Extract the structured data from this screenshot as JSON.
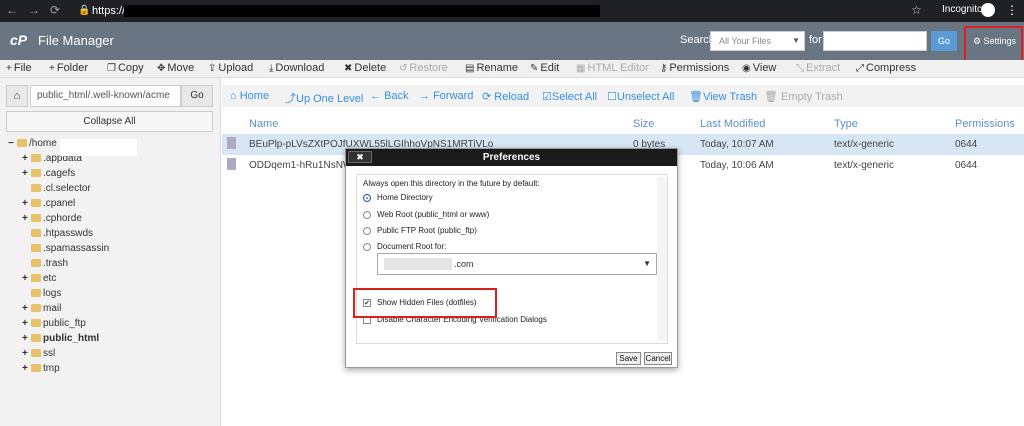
{
  "browser": {
    "url_prefix": "https://",
    "mode_label": "Incognito"
  },
  "header": {
    "app_title": "File Manager",
    "search_label": "Search",
    "search_scope": "All Your Files",
    "for_label": "for",
    "go_label": "Go",
    "settings_label": "Settings"
  },
  "toolbar": [
    {
      "label": "File",
      "icon": "plus-icon",
      "enabled": true
    },
    {
      "label": "Folder",
      "icon": "plus-icon",
      "enabled": true
    },
    {
      "label": "Copy",
      "icon": "copy-icon",
      "enabled": true
    },
    {
      "label": "Move",
      "icon": "move-icon",
      "enabled": true
    },
    {
      "label": "Upload",
      "icon": "upload-icon",
      "enabled": true
    },
    {
      "label": "Download",
      "icon": "download-icon",
      "enabled": true
    },
    {
      "label": "Delete",
      "icon": "delete-icon",
      "enabled": true
    },
    {
      "label": "Restore",
      "icon": "restore-icon",
      "enabled": false
    },
    {
      "label": "Rename",
      "icon": "rename-icon",
      "enabled": true
    },
    {
      "label": "Edit",
      "icon": "edit-icon",
      "enabled": true
    },
    {
      "label": "HTML Editor",
      "icon": "html-editor-icon",
      "enabled": false
    },
    {
      "label": "Permissions",
      "icon": "key-icon",
      "enabled": true
    },
    {
      "label": "View",
      "icon": "eye-icon",
      "enabled": true
    },
    {
      "label": "Extract",
      "icon": "extract-icon",
      "enabled": false
    },
    {
      "label": "Compress",
      "icon": "compress-icon",
      "enabled": true
    }
  ],
  "sidebar": {
    "path_value": "public_html/.well-known/acme",
    "go_label": "Go",
    "collapse_label": "Collapse All",
    "tree": [
      {
        "label": "/home",
        "expander": "−",
        "level": 0,
        "bold": false
      },
      {
        "label": ".appdata",
        "expander": "+",
        "level": 1,
        "bold": false
      },
      {
        "label": ".cagefs",
        "expander": "+",
        "level": 1,
        "bold": false
      },
      {
        "label": ".cl.selector",
        "expander": "",
        "level": 1,
        "bold": false
      },
      {
        "label": ".cpanel",
        "expander": "+",
        "level": 1,
        "bold": false
      },
      {
        "label": ".cphorde",
        "expander": "+",
        "level": 1,
        "bold": false
      },
      {
        "label": ".htpasswds",
        "expander": "",
        "level": 1,
        "bold": false
      },
      {
        "label": ".spamassassin",
        "expander": "",
        "level": 1,
        "bold": false
      },
      {
        "label": ".trash",
        "expander": "",
        "level": 1,
        "bold": false
      },
      {
        "label": "etc",
        "expander": "+",
        "level": 1,
        "bold": false
      },
      {
        "label": "logs",
        "expander": "",
        "level": 1,
        "bold": false
      },
      {
        "label": "mail",
        "expander": "+",
        "level": 1,
        "bold": false
      },
      {
        "label": "public_ftp",
        "expander": "+",
        "level": 1,
        "bold": false
      },
      {
        "label": "public_html",
        "expander": "+",
        "level": 1,
        "bold": true
      },
      {
        "label": "ssl",
        "expander": "+",
        "level": 1,
        "bold": false
      },
      {
        "label": "tmp",
        "expander": "+",
        "level": 1,
        "bold": false
      }
    ]
  },
  "nav": [
    {
      "label": "Home",
      "enabled": true
    },
    {
      "label": "Up One Level",
      "enabled": true
    },
    {
      "label": "Back",
      "enabled": true
    },
    {
      "label": "Forward",
      "enabled": true
    },
    {
      "label": "Reload",
      "enabled": true
    },
    {
      "label": "Select All",
      "enabled": true
    },
    {
      "label": "Unselect All",
      "enabled": true
    },
    {
      "label": "View Trash",
      "enabled": true
    },
    {
      "label": "Empty Trash",
      "enabled": false
    }
  ],
  "columns": [
    "Name",
    "Size",
    "Last Modified",
    "Type",
    "Permissions"
  ],
  "files": [
    {
      "name": "BEuPlp-pLVsZXtPOJfUXWL55lLGIhhoVpNS1MRTiVLo",
      "size": "0 bytes",
      "modified": "Today, 10:07 AM",
      "type": "text/x-generic",
      "perms": "0644"
    },
    {
      "name": "ODDqem1-hRu1NsNW",
      "size": "",
      "modified": "Today, 10:06 AM",
      "type": "text/x-generic",
      "perms": "0644"
    }
  ],
  "dialog": {
    "title": "Preferences",
    "close_label": "✖",
    "intro": "Always open this directory in the future by default:",
    "options": [
      {
        "label": "Home Directory",
        "checked": true
      },
      {
        "label": "Web Root (public_html or www)",
        "checked": false
      },
      {
        "label": "Public FTP Root (public_ftp)",
        "checked": false
      },
      {
        "label": "Document Root for:",
        "checked": false
      }
    ],
    "docroot_value": ".com",
    "show_hidden_label": "Show Hidden Files (dotfiles)",
    "show_hidden_checked": true,
    "disable_encoding_label": "Disable Character Encoding Verification Dialogs",
    "disable_encoding_checked": false,
    "save_label": "Save",
    "cancel_label": "Cancel"
  },
  "colors": {
    "header_bg": "#6a7584",
    "accent": "#3a8dde",
    "highlight": "#e02020"
  }
}
